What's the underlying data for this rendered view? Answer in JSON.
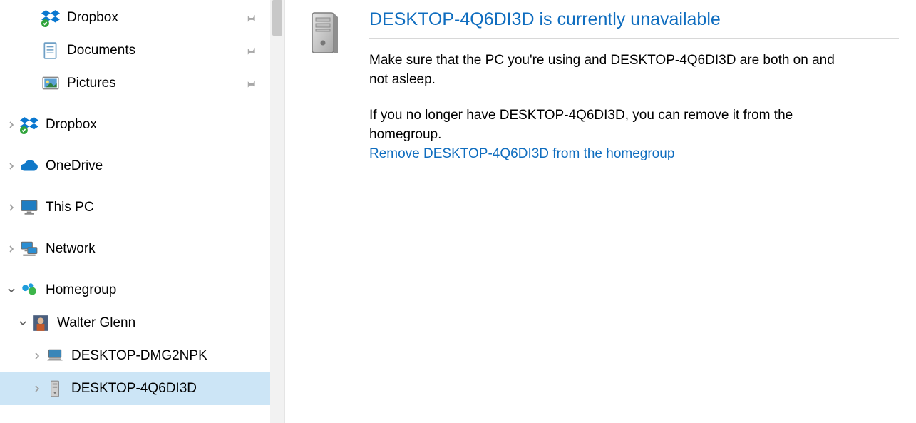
{
  "sidebar": {
    "quick_access": [
      {
        "label": "Dropbox",
        "icon": "dropbox-icon"
      },
      {
        "label": "Documents",
        "icon": "documents-icon"
      },
      {
        "label": "Pictures",
        "icon": "pictures-icon"
      }
    ],
    "dropbox": {
      "label": "Dropbox"
    },
    "onedrive": {
      "label": "OneDrive"
    },
    "thispc": {
      "label": "This PC"
    },
    "network": {
      "label": "Network"
    },
    "homegroup": {
      "label": "Homegroup",
      "user": {
        "label": "Walter Glenn"
      },
      "machines": [
        {
          "label": "DESKTOP-DMG2NPK",
          "selected": false
        },
        {
          "label": "DESKTOP-4Q6DI3D",
          "selected": true
        }
      ]
    }
  },
  "main": {
    "headline": "DESKTOP-4Q6DI3D is currently unavailable",
    "msg1": "Make sure that the PC you're using and DESKTOP-4Q6DI3D are both on and not asleep.",
    "msg2": "If you no longer have DESKTOP-4Q6DI3D, you can remove it from the homegroup.",
    "link": "Remove DESKTOP-4Q6DI3D from the homegroup"
  }
}
